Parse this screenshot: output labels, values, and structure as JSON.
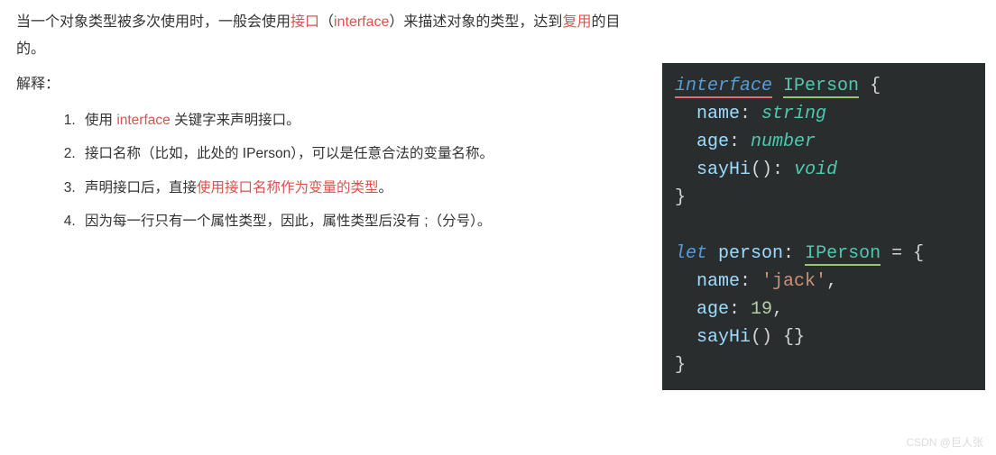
{
  "intro": {
    "p1": "当一个对象类型被多次使用时，一般会使用",
    "p2_red": "接口",
    "p3": "（",
    "p4_red": "interface",
    "p5": "）来描述对象的类型，达到",
    "p6_red": "复用",
    "p7": "的目的。"
  },
  "explain_label": "解释：",
  "items": [
    {
      "a": "使用 ",
      "b_red": "interface",
      "c": " 关键字来声明接口。"
    },
    {
      "a": "接口名称（比如，此处的 IPerson），可以是任意合法的变量名称。",
      "b_red": "",
      "c": ""
    },
    {
      "a": "声明接口后，直接",
      "b_red": "使用接口名称作为变量的类型",
      "c": "。"
    },
    {
      "a": "因为每一行只有一个属性类型，因此，属性类型后没有 ;（分号）。",
      "b_red": "",
      "c": ""
    }
  ],
  "code": {
    "l1_kw": "interface",
    "l1_cls": "IPerson",
    "l1_brace": " {",
    "l2_prop": "name",
    "l2_colon": ": ",
    "l2_type": "string",
    "l3_prop": "age",
    "l3_colon": ": ",
    "l3_type": "number",
    "l4_prop": "sayHi",
    "l4_paren": "()",
    "l4_colon": ": ",
    "l4_type": "void",
    "l5_brace": "}",
    "l7_let": "let",
    "l7_var": "person",
    "l7_colon": ": ",
    "l7_cls": "IPerson",
    "l7_eq": " = {",
    "l8_prop": "name",
    "l8_colon": ": ",
    "l8_val": "'jack'",
    "l8_comma": ",",
    "l9_prop": "age",
    "l9_colon": ": ",
    "l9_val": "19",
    "l9_comma": ",",
    "l10_prop": "sayHi",
    "l10_rest": "() {}",
    "l11_brace": "}"
  },
  "watermark": "CSDN @巨人张"
}
